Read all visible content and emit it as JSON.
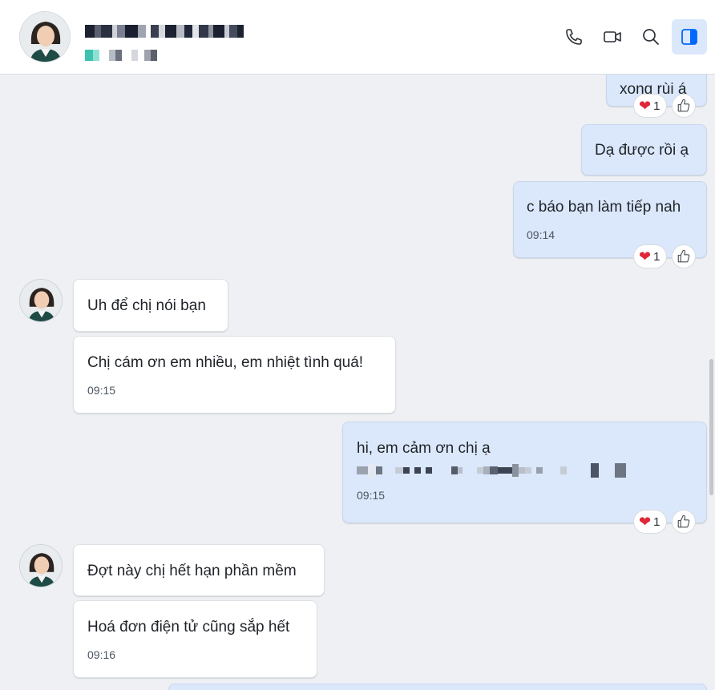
{
  "header": {
    "avatar_icon": "avatar-contact",
    "actions": {
      "call_icon": "phone-icon",
      "video_icon": "video-icon",
      "search_icon": "search-icon",
      "panel_icon": "sidebar-toggle-icon"
    }
  },
  "messages": [
    {
      "id": "m1",
      "direction": "out",
      "text": "xong rùi á",
      "reaction_count": "1"
    },
    {
      "id": "m2",
      "direction": "out",
      "text": "Dạ được rồi ạ"
    },
    {
      "id": "m3",
      "direction": "out",
      "text": "c báo bạn làm tiếp nah",
      "time": "09:14",
      "reaction_count": "1"
    },
    {
      "id": "m4",
      "direction": "in",
      "text": "Uh để chị nói bạn"
    },
    {
      "id": "m5",
      "direction": "in",
      "text": "Chị cám ơn em nhiều, em nhiệt tình quá!",
      "time": "09:15"
    },
    {
      "id": "m6",
      "direction": "out",
      "text": "hi, em cảm ơn chị ạ",
      "time": "09:15",
      "reaction_count": "1"
    },
    {
      "id": "m7",
      "direction": "in",
      "text": "Đợt này chị hết hạn phần mềm"
    },
    {
      "id": "m8",
      "direction": "in",
      "text": "Hoá đơn điện tử cũng sắp hết",
      "time": "09:16"
    }
  ],
  "colors": {
    "out_bubble": "#dbe8fb",
    "in_bubble": "#ffffff",
    "background": "#eef0f3",
    "heart": "#e0263a"
  }
}
